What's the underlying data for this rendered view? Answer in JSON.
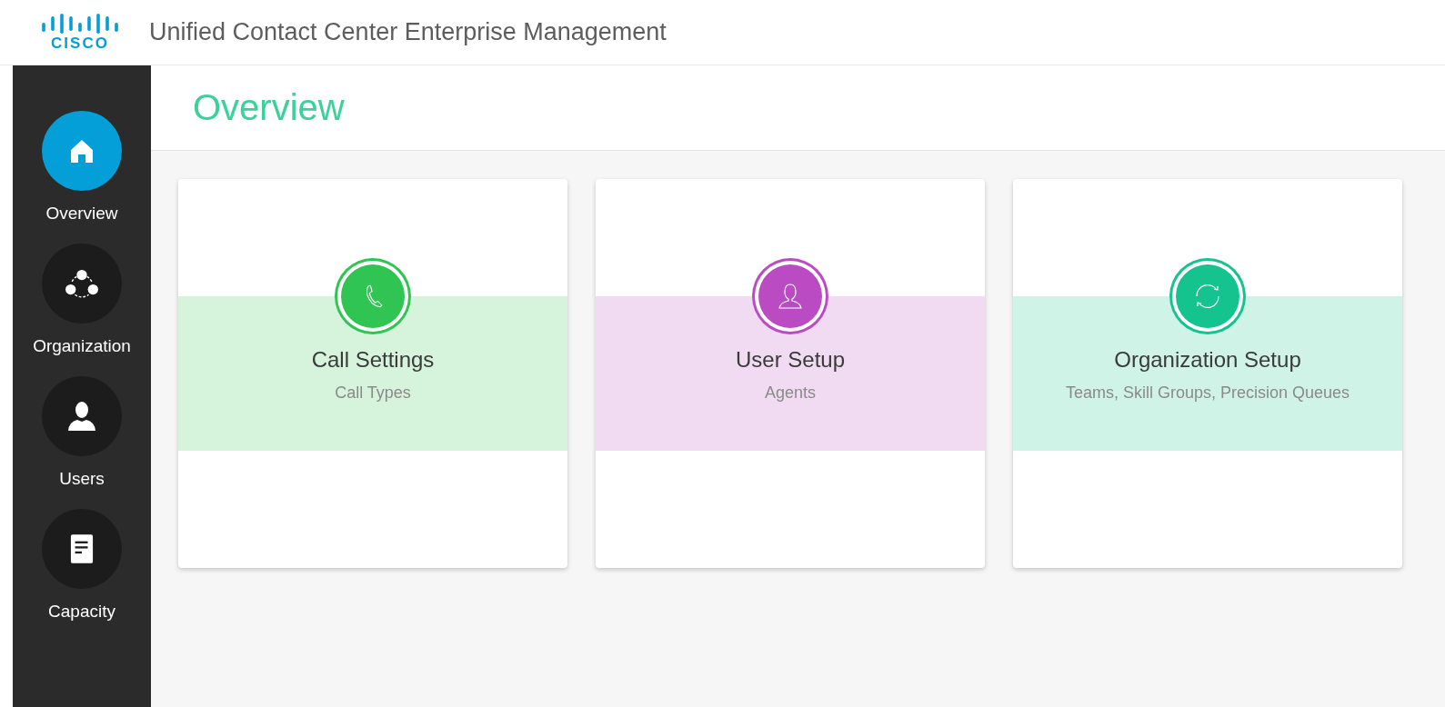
{
  "header": {
    "logo_text": "CISCO",
    "title": "Unified Contact Center Enterprise Management"
  },
  "sidebar": {
    "items": [
      {
        "label": "Overview",
        "kind": "home",
        "selected": true
      },
      {
        "label": "Organization",
        "kind": "organization",
        "selected": false
      },
      {
        "label": "Users",
        "kind": "user",
        "selected": false
      },
      {
        "label": "Capacity",
        "kind": "document",
        "selected": false
      }
    ]
  },
  "page": {
    "title": "Overview"
  },
  "cards": [
    {
      "title": "Call Settings",
      "subtitle": "Call Types",
      "kind": "phone",
      "color": "#30c552"
    },
    {
      "title": "User Setup",
      "subtitle": "Agents",
      "kind": "user",
      "color": "#bb4bc2"
    },
    {
      "title": "Organization Setup",
      "subtitle": "Teams, Skill Groups, Precision Queues",
      "kind": "sync",
      "color": "#14c38d"
    }
  ]
}
